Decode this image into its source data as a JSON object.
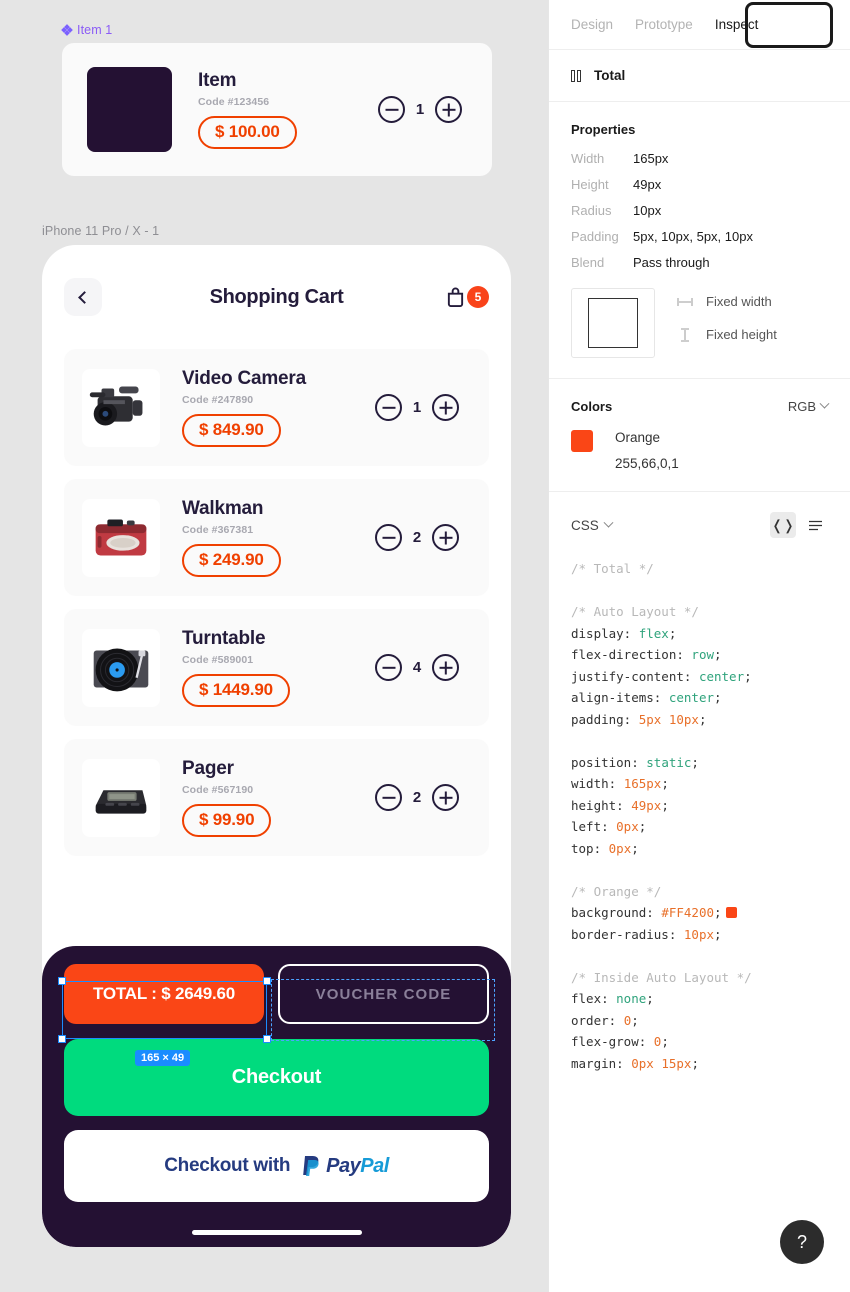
{
  "canvas": {
    "component_label": "Item 1",
    "frame_label": "iPhone 11 Pro / X - 1",
    "item_component": {
      "name": "Item",
      "code": "Code #123456",
      "price": "$ 100.00",
      "qty": "1"
    },
    "phone": {
      "header_title": "Shopping Cart",
      "cart_badge": "5",
      "items": [
        {
          "name": "Video Camera",
          "code": "Code #247890",
          "price": "$ 849.90",
          "qty": "1",
          "thumb": "video-camera"
        },
        {
          "name": "Walkman",
          "code": "Code #367381",
          "price": "$ 249.90",
          "qty": "2",
          "thumb": "walkman"
        },
        {
          "name": "Turntable",
          "code": "Code #589001",
          "price": "$ 1449.90",
          "qty": "4",
          "thumb": "turntable"
        },
        {
          "name": "Pager",
          "code": "Code #567190",
          "price": "$ 99.90",
          "qty": "2",
          "thumb": "pager"
        }
      ],
      "total_label": "TOTAL : $ 2649.60",
      "voucher_label": "VOUCHER CODE",
      "checkout_label": "Checkout",
      "paypal_label": "Checkout with",
      "paypal_pay": "Pay",
      "paypal_pal": "Pal"
    },
    "selection": {
      "size_badge": "165 × 49"
    },
    "colors": {
      "orange_button": "#FA4616",
      "dark_footer": "#241133",
      "green_checkout": "#00DB7E",
      "price_outline": "#F04000",
      "selection_blue": "#1A8CFF"
    }
  },
  "panel": {
    "tabs": [
      {
        "label": "Design",
        "active": false
      },
      {
        "label": "Prototype",
        "active": false
      },
      {
        "label": "Inspect",
        "active": true
      }
    ],
    "object_name": "Total",
    "properties": {
      "title": "Properties",
      "rows": [
        {
          "key": "Width",
          "value": "165px"
        },
        {
          "key": "Height",
          "value": "49px"
        },
        {
          "key": "Radius",
          "value": "10px"
        },
        {
          "key": "Padding",
          "value": "5px, 10px, 5px, 10px"
        },
        {
          "key": "Blend",
          "value": "Pass through"
        }
      ],
      "constraints": [
        {
          "label": "Fixed width"
        },
        {
          "label": "Fixed height"
        }
      ]
    },
    "colors": {
      "title": "Colors",
      "mode": "RGB",
      "swatch_hex": "#FA4616",
      "name": "Orange",
      "value": "255,66,0,1"
    },
    "css": {
      "label": "CSS",
      "view_code_icon": "code-brackets-icon",
      "view_list_icon": "list-icon",
      "lines": [
        {
          "t": "comment",
          "text": "/* Total */"
        },
        {
          "t": "blank"
        },
        {
          "t": "comment",
          "text": "/* Auto Layout */"
        },
        {
          "t": "decl",
          "prop": "display",
          "val": "flex",
          "vtype": "kw"
        },
        {
          "t": "decl",
          "prop": "flex-direction",
          "val": "row",
          "vtype": "kw"
        },
        {
          "t": "decl",
          "prop": "justify-content",
          "val": "center",
          "vtype": "kw"
        },
        {
          "t": "decl",
          "prop": "align-items",
          "val": "center",
          "vtype": "kw"
        },
        {
          "t": "decl",
          "prop": "padding",
          "val": "5px 10px",
          "vtype": "num"
        },
        {
          "t": "blank"
        },
        {
          "t": "decl",
          "prop": "position",
          "val": "static",
          "vtype": "kw"
        },
        {
          "t": "decl",
          "prop": "width",
          "val": "165px",
          "vtype": "num"
        },
        {
          "t": "decl",
          "prop": "height",
          "val": "49px",
          "vtype": "num"
        },
        {
          "t": "decl",
          "prop": "left",
          "val": "0px",
          "vtype": "num"
        },
        {
          "t": "decl",
          "prop": "top",
          "val": "0px",
          "vtype": "num"
        },
        {
          "t": "blank"
        },
        {
          "t": "comment",
          "text": "/* Orange */"
        },
        {
          "t": "decl",
          "prop": "background",
          "val": "#FF4200",
          "vtype": "num",
          "chip": "#FA4616"
        },
        {
          "t": "decl",
          "prop": "border-radius",
          "val": "10px",
          "vtype": "num"
        },
        {
          "t": "blank"
        },
        {
          "t": "comment",
          "text": "/* Inside Auto Layout */"
        },
        {
          "t": "decl",
          "prop": "flex",
          "val": "none",
          "vtype": "kw"
        },
        {
          "t": "decl",
          "prop": "order",
          "val": "0",
          "vtype": "num"
        },
        {
          "t": "decl",
          "prop": "flex-grow",
          "val": "0",
          "vtype": "num"
        },
        {
          "t": "decl",
          "prop": "margin",
          "val": "0px 15px",
          "vtype": "num"
        }
      ]
    },
    "help_label": "?"
  }
}
